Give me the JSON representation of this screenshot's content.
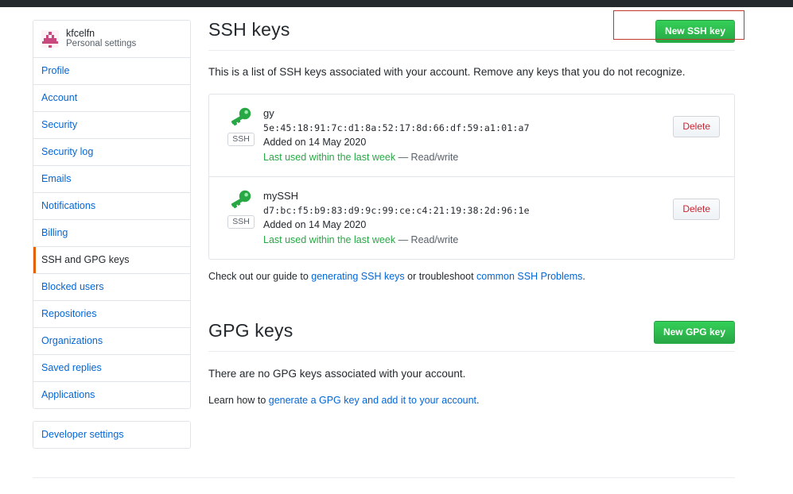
{
  "sidebar": {
    "profile": {
      "name": "kfcelfn",
      "subtitle": "Personal settings",
      "avatar_icon": "identicon-avatar"
    },
    "items": [
      {
        "label": "Profile",
        "active": false
      },
      {
        "label": "Account",
        "active": false
      },
      {
        "label": "Security",
        "active": false
      },
      {
        "label": "Security log",
        "active": false
      },
      {
        "label": "Emails",
        "active": false
      },
      {
        "label": "Notifications",
        "active": false
      },
      {
        "label": "Billing",
        "active": false
      },
      {
        "label": "SSH and GPG keys",
        "active": true
      },
      {
        "label": "Blocked users",
        "active": false
      },
      {
        "label": "Repositories",
        "active": false
      },
      {
        "label": "Organizations",
        "active": false
      },
      {
        "label": "Saved replies",
        "active": false
      },
      {
        "label": "Applications",
        "active": false
      }
    ],
    "secondary_items": [
      {
        "label": "Developer settings"
      }
    ]
  },
  "ssh_section": {
    "title": "SSH keys",
    "new_button": "New SSH key",
    "description": "This is a list of SSH keys associated with your account. Remove any keys that you do not recognize.",
    "keys": [
      {
        "name": "gy",
        "fingerprint": "5e:45:18:91:7c:d1:8a:52:17:8d:66:df:59:a1:01:a7",
        "added": "Added on 14 May 2020",
        "last_used": "Last used within the last week",
        "access": "— Read/write",
        "badge": "SSH",
        "key_icon": "key-icon",
        "delete_label": "Delete"
      },
      {
        "name": "mySSH",
        "fingerprint": "d7:bc:f5:b9:83:d9:9c:99:ce:c4:21:19:38:2d:96:1e",
        "added": "Added on 14 May 2020",
        "last_used": "Last used within the last week",
        "access": "— Read/write",
        "badge": "SSH",
        "key_icon": "key-icon",
        "delete_label": "Delete"
      }
    ],
    "guide": {
      "prefix": "Check out our guide to ",
      "link1": "generating SSH keys",
      "middle": " or troubleshoot ",
      "link2": "common SSH Problems",
      "suffix": "."
    }
  },
  "gpg_section": {
    "title": "GPG keys",
    "new_button": "New GPG key",
    "empty_text": "There are no GPG keys associated with your account.",
    "learn_prefix": "Learn how to ",
    "learn_link": "generate a GPG key and add it to your account",
    "learn_suffix": "."
  },
  "annotations": {
    "box_color": "#c0392b",
    "targets": [
      "new-ssh-key-button",
      "sidebar-item-ssh-and-gpg-keys"
    ]
  },
  "colors": {
    "accent_green": "#2cbe4e",
    "link_blue": "#0366d6",
    "danger_red": "#cb2431",
    "active_marker_orange": "#e36209",
    "topbar": "#24292e"
  }
}
